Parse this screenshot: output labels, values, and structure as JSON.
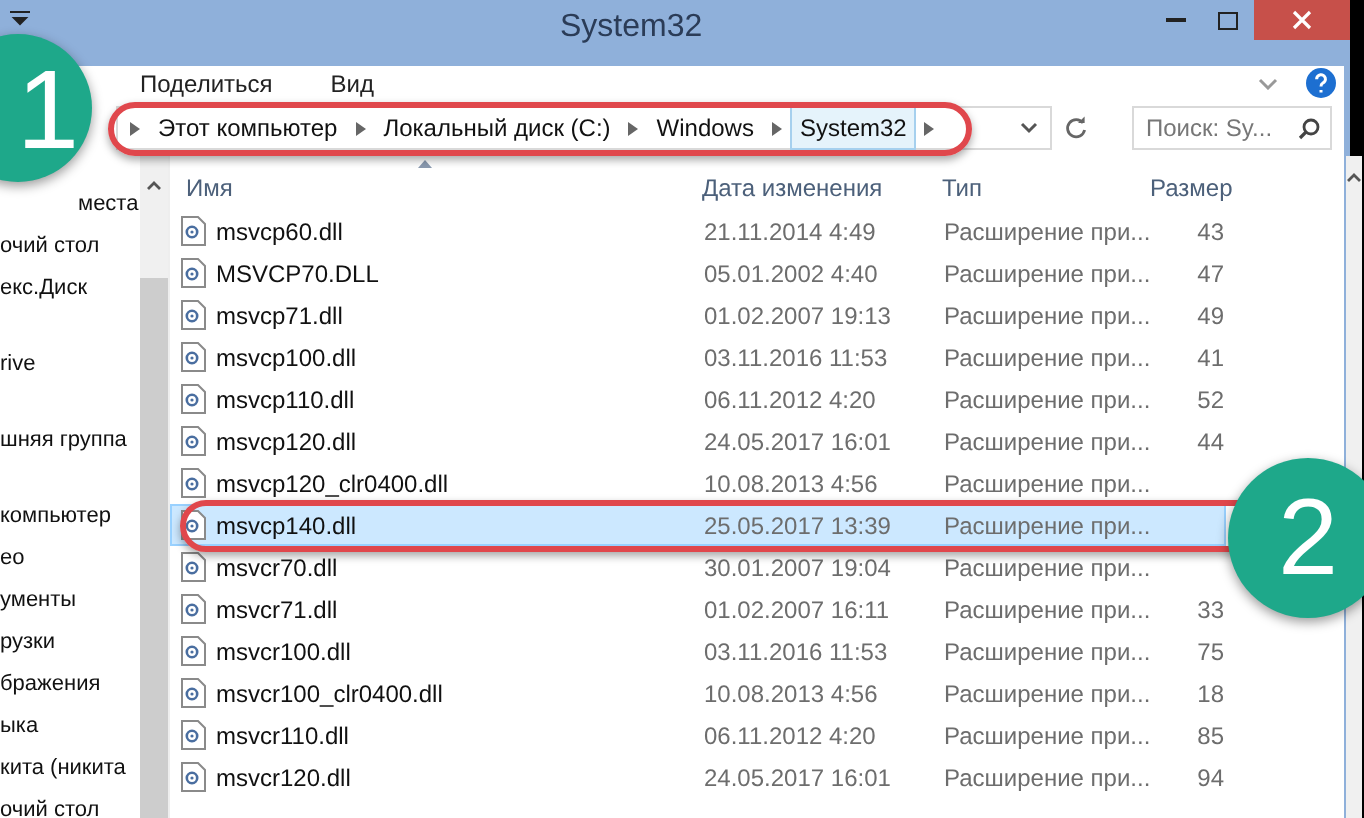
{
  "window": {
    "title": "System32"
  },
  "ribbon_tabs": [
    {
      "label": "Поделиться"
    },
    {
      "label": "Вид"
    }
  ],
  "breadcrumb": [
    {
      "label": "Этот компьютер",
      "selected": false
    },
    {
      "label": "Локальный диск (C:)",
      "selected": false
    },
    {
      "label": "Windows",
      "selected": false
    },
    {
      "label": "System32",
      "selected": true
    }
  ],
  "search": {
    "placeholder": "Поиск: Sy..."
  },
  "navigation": [
    {
      "items": [
        "места",
        "очий стол",
        "екс.Диск"
      ]
    },
    {
      "items": [
        "rive"
      ]
    },
    {
      "items": [
        "шняя группа"
      ]
    },
    {
      "items": [
        "компьютер",
        "ео",
        "ументы",
        "рузки",
        "бражения",
        "ыка",
        "кита (никита",
        "очий стол"
      ]
    }
  ],
  "table": {
    "columns": [
      "Имя",
      "Дата изменения",
      "Тип",
      "Размер"
    ],
    "rows": [
      {
        "name": "msvcp60.dll",
        "date": "21.11.2014 4:49",
        "type": "Расширение при...",
        "size": "43",
        "selected": false
      },
      {
        "name": "MSVCP70.DLL",
        "date": "05.01.2002 4:40",
        "type": "Расширение при...",
        "size": "47",
        "selected": false
      },
      {
        "name": "msvcp71.dll",
        "date": "01.02.2007 19:13",
        "type": "Расширение при...",
        "size": "49",
        "selected": false
      },
      {
        "name": "msvcp100.dll",
        "date": "03.11.2016 11:53",
        "type": "Расширение при...",
        "size": "41",
        "selected": false
      },
      {
        "name": "msvcp110.dll",
        "date": "06.11.2012 4:20",
        "type": "Расширение при...",
        "size": "52",
        "selected": false
      },
      {
        "name": "msvcp120.dll",
        "date": "24.05.2017 16:01",
        "type": "Расширение при...",
        "size": "44",
        "selected": false
      },
      {
        "name": "msvcp120_clr0400.dll",
        "date": "10.08.2013 4:56",
        "type": "Расширение при...",
        "selected": false
      },
      {
        "name": "msvcp140.dll",
        "date": "25.05.2017 13:39",
        "type": "Расширение при...",
        "selected": true
      },
      {
        "name": "msvcr70.dll",
        "date": "30.01.2007 19:04",
        "type": "Расширение при...",
        "selected": false
      },
      {
        "name": "msvcr71.dll",
        "date": "01.02.2007 16:11",
        "type": "Расширение при...",
        "size": "33",
        "selected": false
      },
      {
        "name": "msvcr100.dll",
        "date": "03.11.2016 11:53",
        "type": "Расширение при...",
        "size": "75",
        "selected": false
      },
      {
        "name": "msvcr100_clr0400.dll",
        "date": "10.08.2013 4:56",
        "type": "Расширение при...",
        "size": "18",
        "selected": false
      },
      {
        "name": "msvcr110.dll",
        "date": "06.11.2012 4:20",
        "type": "Расширение при...",
        "size": "85",
        "selected": false
      },
      {
        "name": "msvcr120.dll",
        "date": "24.05.2017 16:01",
        "type": "Расширение при...",
        "size": "94",
        "selected": false
      }
    ]
  },
  "annotations": [
    {
      "label": "1"
    },
    {
      "label": "2"
    }
  ]
}
